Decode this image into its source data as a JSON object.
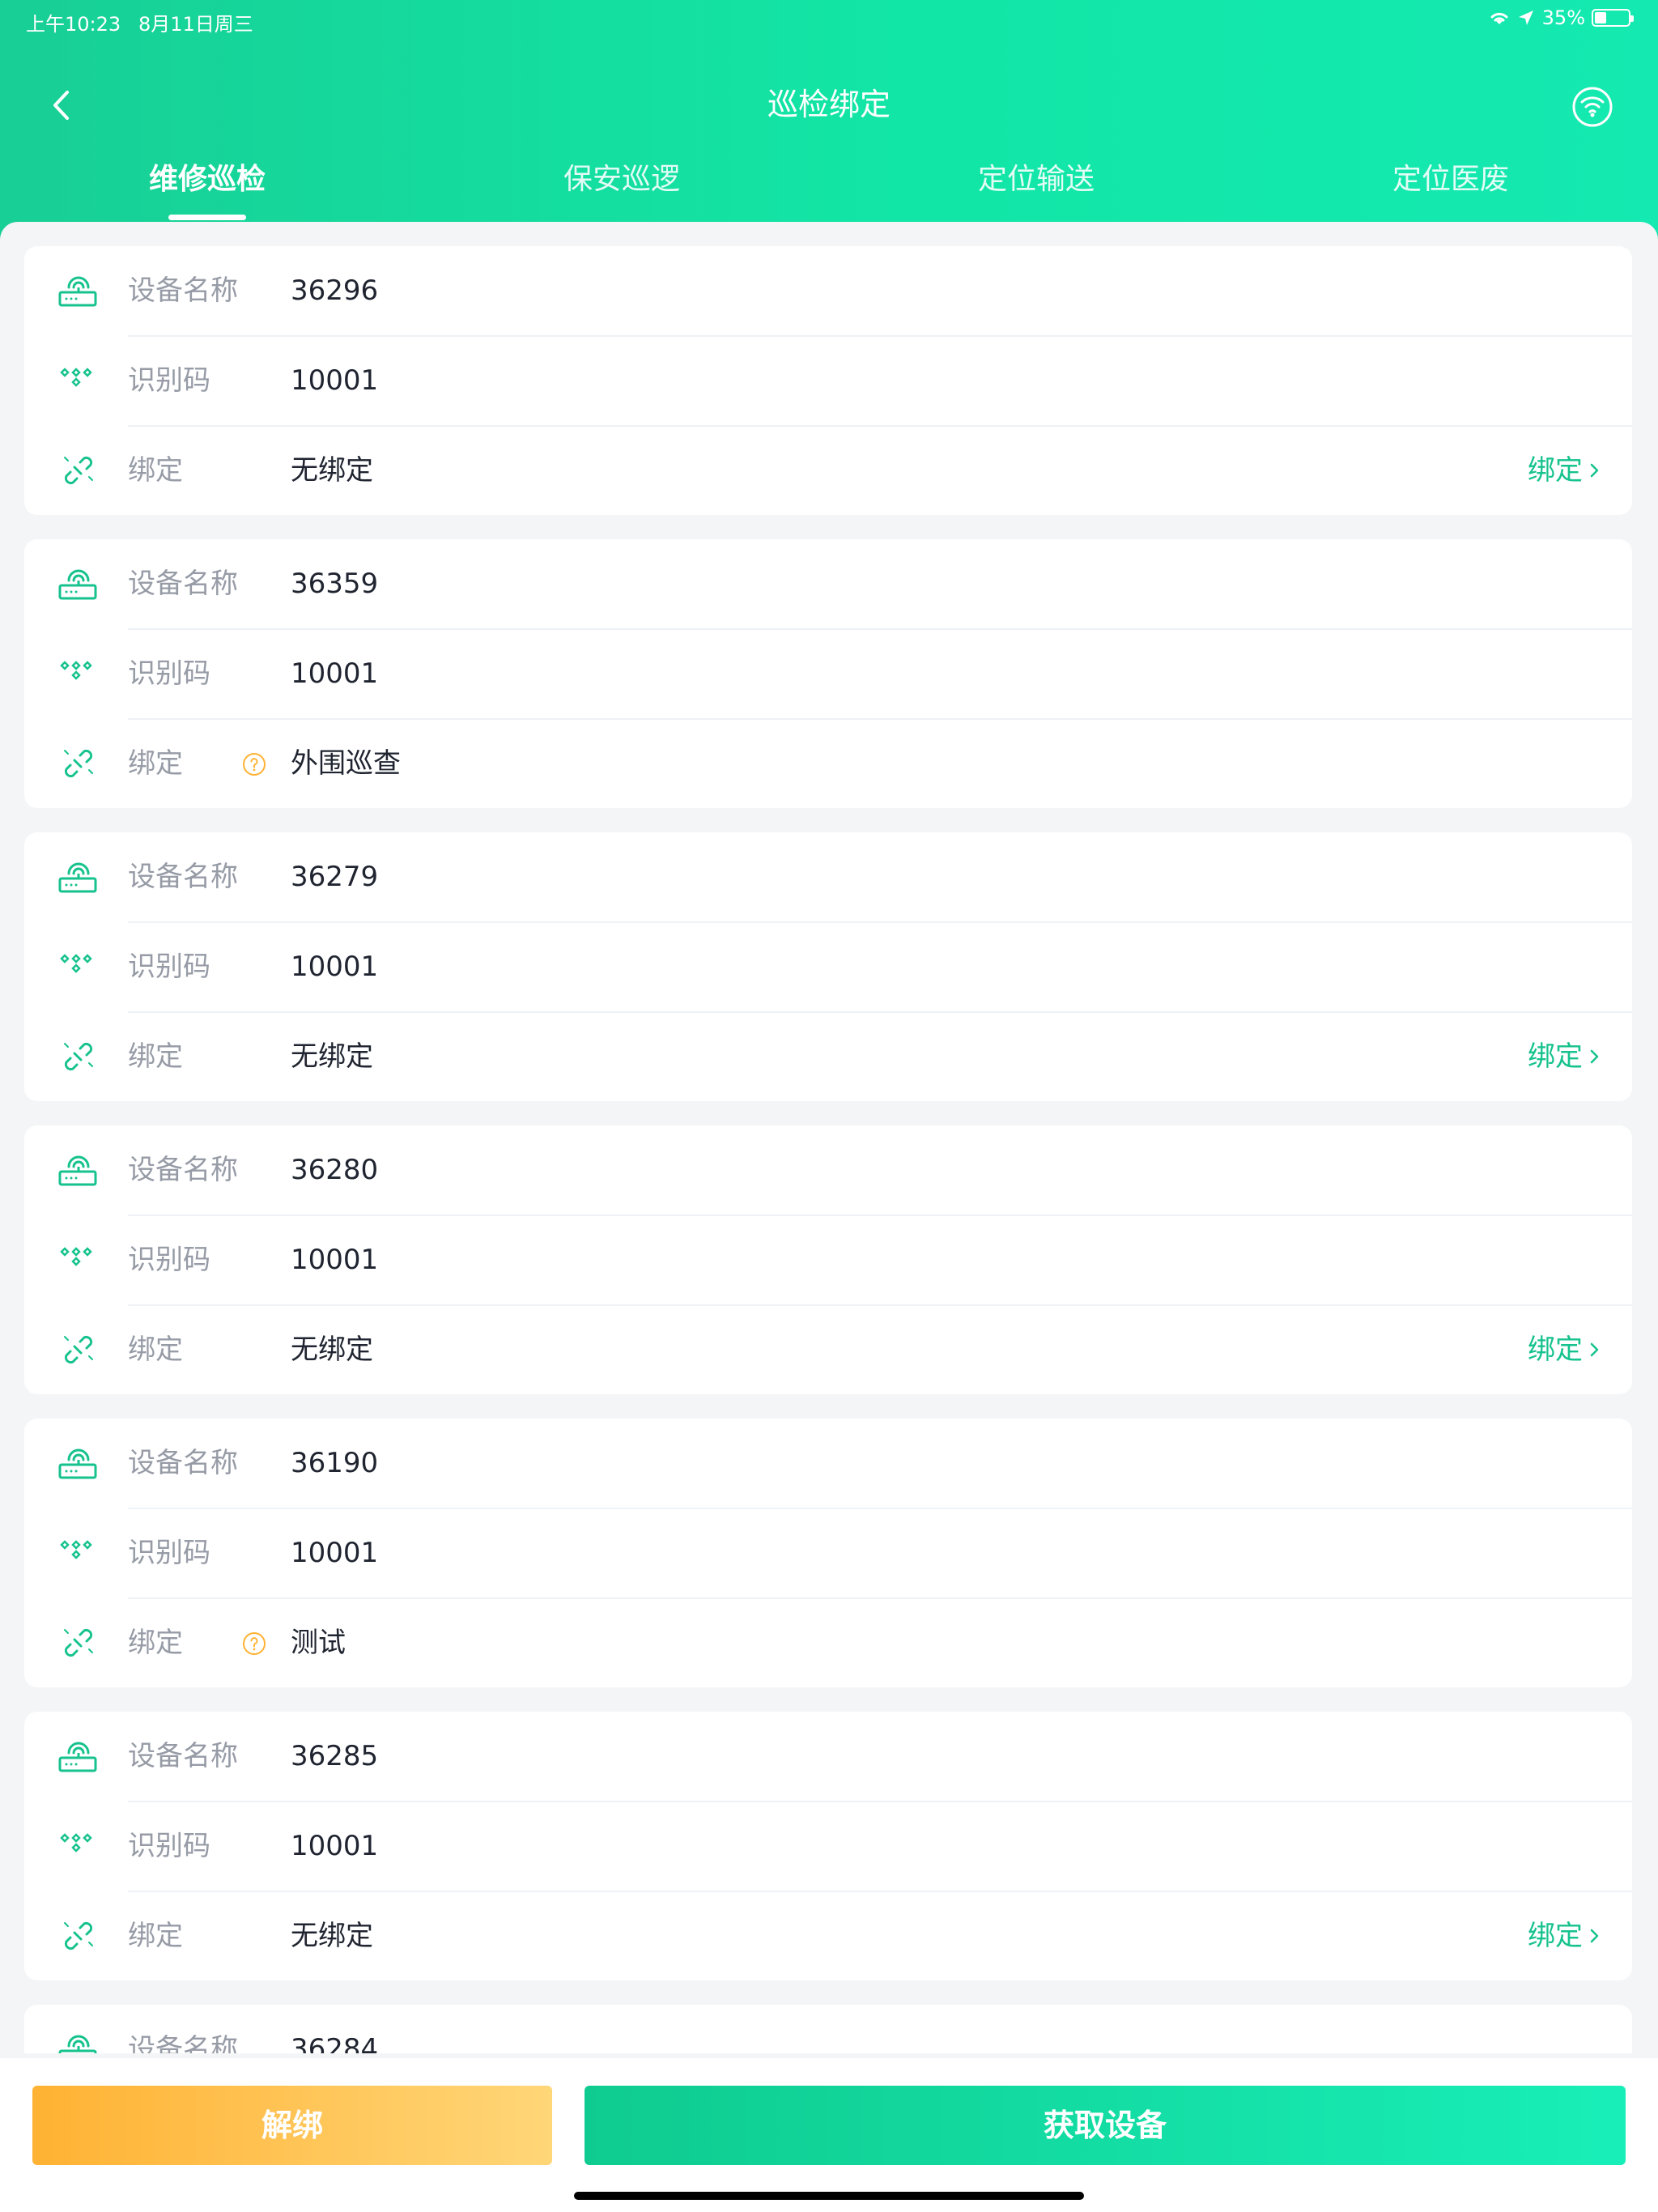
{
  "status_bar": {
    "time": "上午10:23",
    "date": "8月11日周三",
    "battery_percent": "35%",
    "battery_level": 0.35
  },
  "header": {
    "title": "巡检绑定",
    "tabs": [
      {
        "label": "维修巡检",
        "active": true
      },
      {
        "label": "保安巡逻",
        "active": false
      },
      {
        "label": "定位输送",
        "active": false
      },
      {
        "label": "定位医废",
        "active": false
      }
    ]
  },
  "labels": {
    "device_name": "设备名称",
    "id_code": "识别码",
    "binding": "绑定"
  },
  "devices": [
    {
      "name": "36296",
      "id_code": "10001",
      "binding": "无绑定",
      "action": "绑定",
      "help": false
    },
    {
      "name": "36359",
      "id_code": "10001",
      "binding": "外围巡查",
      "action": "",
      "help": true
    },
    {
      "name": "36279",
      "id_code": "10001",
      "binding": "无绑定",
      "action": "绑定",
      "help": false
    },
    {
      "name": "36280",
      "id_code": "10001",
      "binding": "无绑定",
      "action": "绑定",
      "help": false
    },
    {
      "name": "36190",
      "id_code": "10001",
      "binding": "测试",
      "action": "",
      "help": true
    },
    {
      "name": "36285",
      "id_code": "10001",
      "binding": "无绑定",
      "action": "绑定",
      "help": false
    },
    {
      "name": "36284",
      "id_code": "",
      "binding": "",
      "action": "",
      "help": false
    }
  ],
  "bottom_bar": {
    "unbind_label": "解绑",
    "get_devices_label": "获取设备"
  },
  "colors": {
    "primary": "#16c28d",
    "warning": "#ffb233",
    "text_primary": "#1f2430",
    "text_secondary": "#969ba6"
  },
  "icons": {
    "back": "chevron-left-icon",
    "signal": "wifi-icon",
    "device": "router-icon",
    "id_code": "code-icon",
    "binding": "link-icon",
    "help": "help-icon",
    "action_arrow": "chevron-right-icon"
  }
}
